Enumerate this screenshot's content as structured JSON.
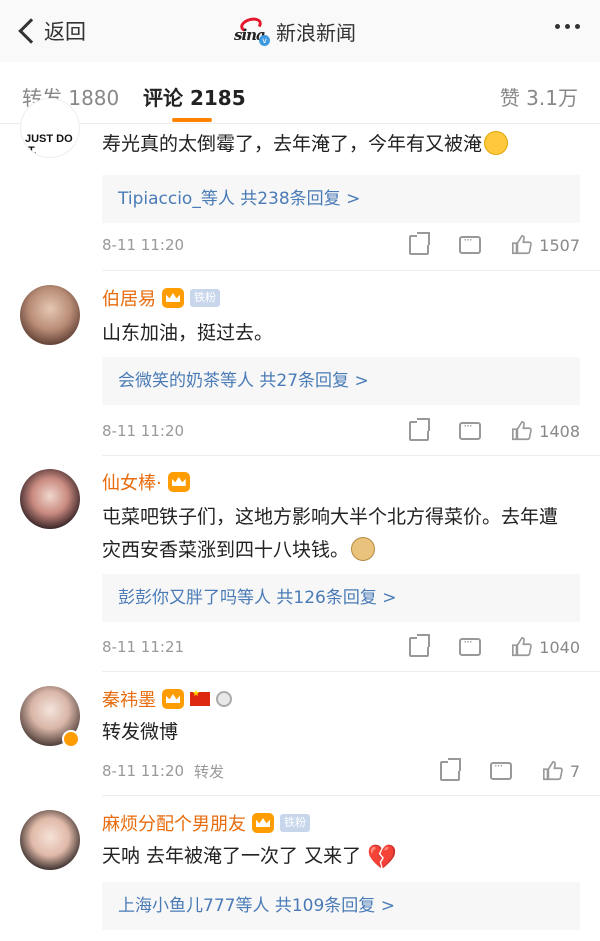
{
  "nav": {
    "back_label": "返回",
    "title": "新浪新闻",
    "logo_text": "sina"
  },
  "tabs": {
    "repost": "转发 1880",
    "comment": "评论 2185",
    "like": "赞 3.1万"
  },
  "comments": [
    {
      "text": "寿光真的太倒霉了，去年淹了，今年有又被淹",
      "avatar_text": "JUST DO IT.",
      "replies": "Tipiaccio_等人  共238条回复 >",
      "time": "8-11 11:20",
      "likes": "1507"
    },
    {
      "name": "伯居易",
      "badge": "铁粉",
      "text": "山东加油，挺过去。",
      "replies": "会微笑的奶茶等人  共27条回复 >",
      "time": "8-11 11:20",
      "likes": "1408"
    },
    {
      "name": "仙女棒·",
      "text": "屯菜吧铁子们，这地方影响大半个北方得菜价。去年遭灾西安香菜涨到四十八块钱。",
      "replies": "彭彭你又胖了吗等人  共126条回复 >",
      "time": "8-11 11:21",
      "likes": "1040"
    },
    {
      "name": "秦祎墨",
      "text": "转发微博",
      "time": "8-11 11:20",
      "repost_tag": "转发",
      "likes": "7"
    },
    {
      "name": "麻烦分配个男朋友",
      "badge": "铁粉",
      "text": "天呐 去年被淹了一次了 又来了",
      "replies": "上海小鱼儿777等人  共109条回复 >"
    }
  ],
  "colors": {
    "accent": "#ff8200",
    "name": "#e86b0c",
    "link": "#4a7bb6"
  }
}
